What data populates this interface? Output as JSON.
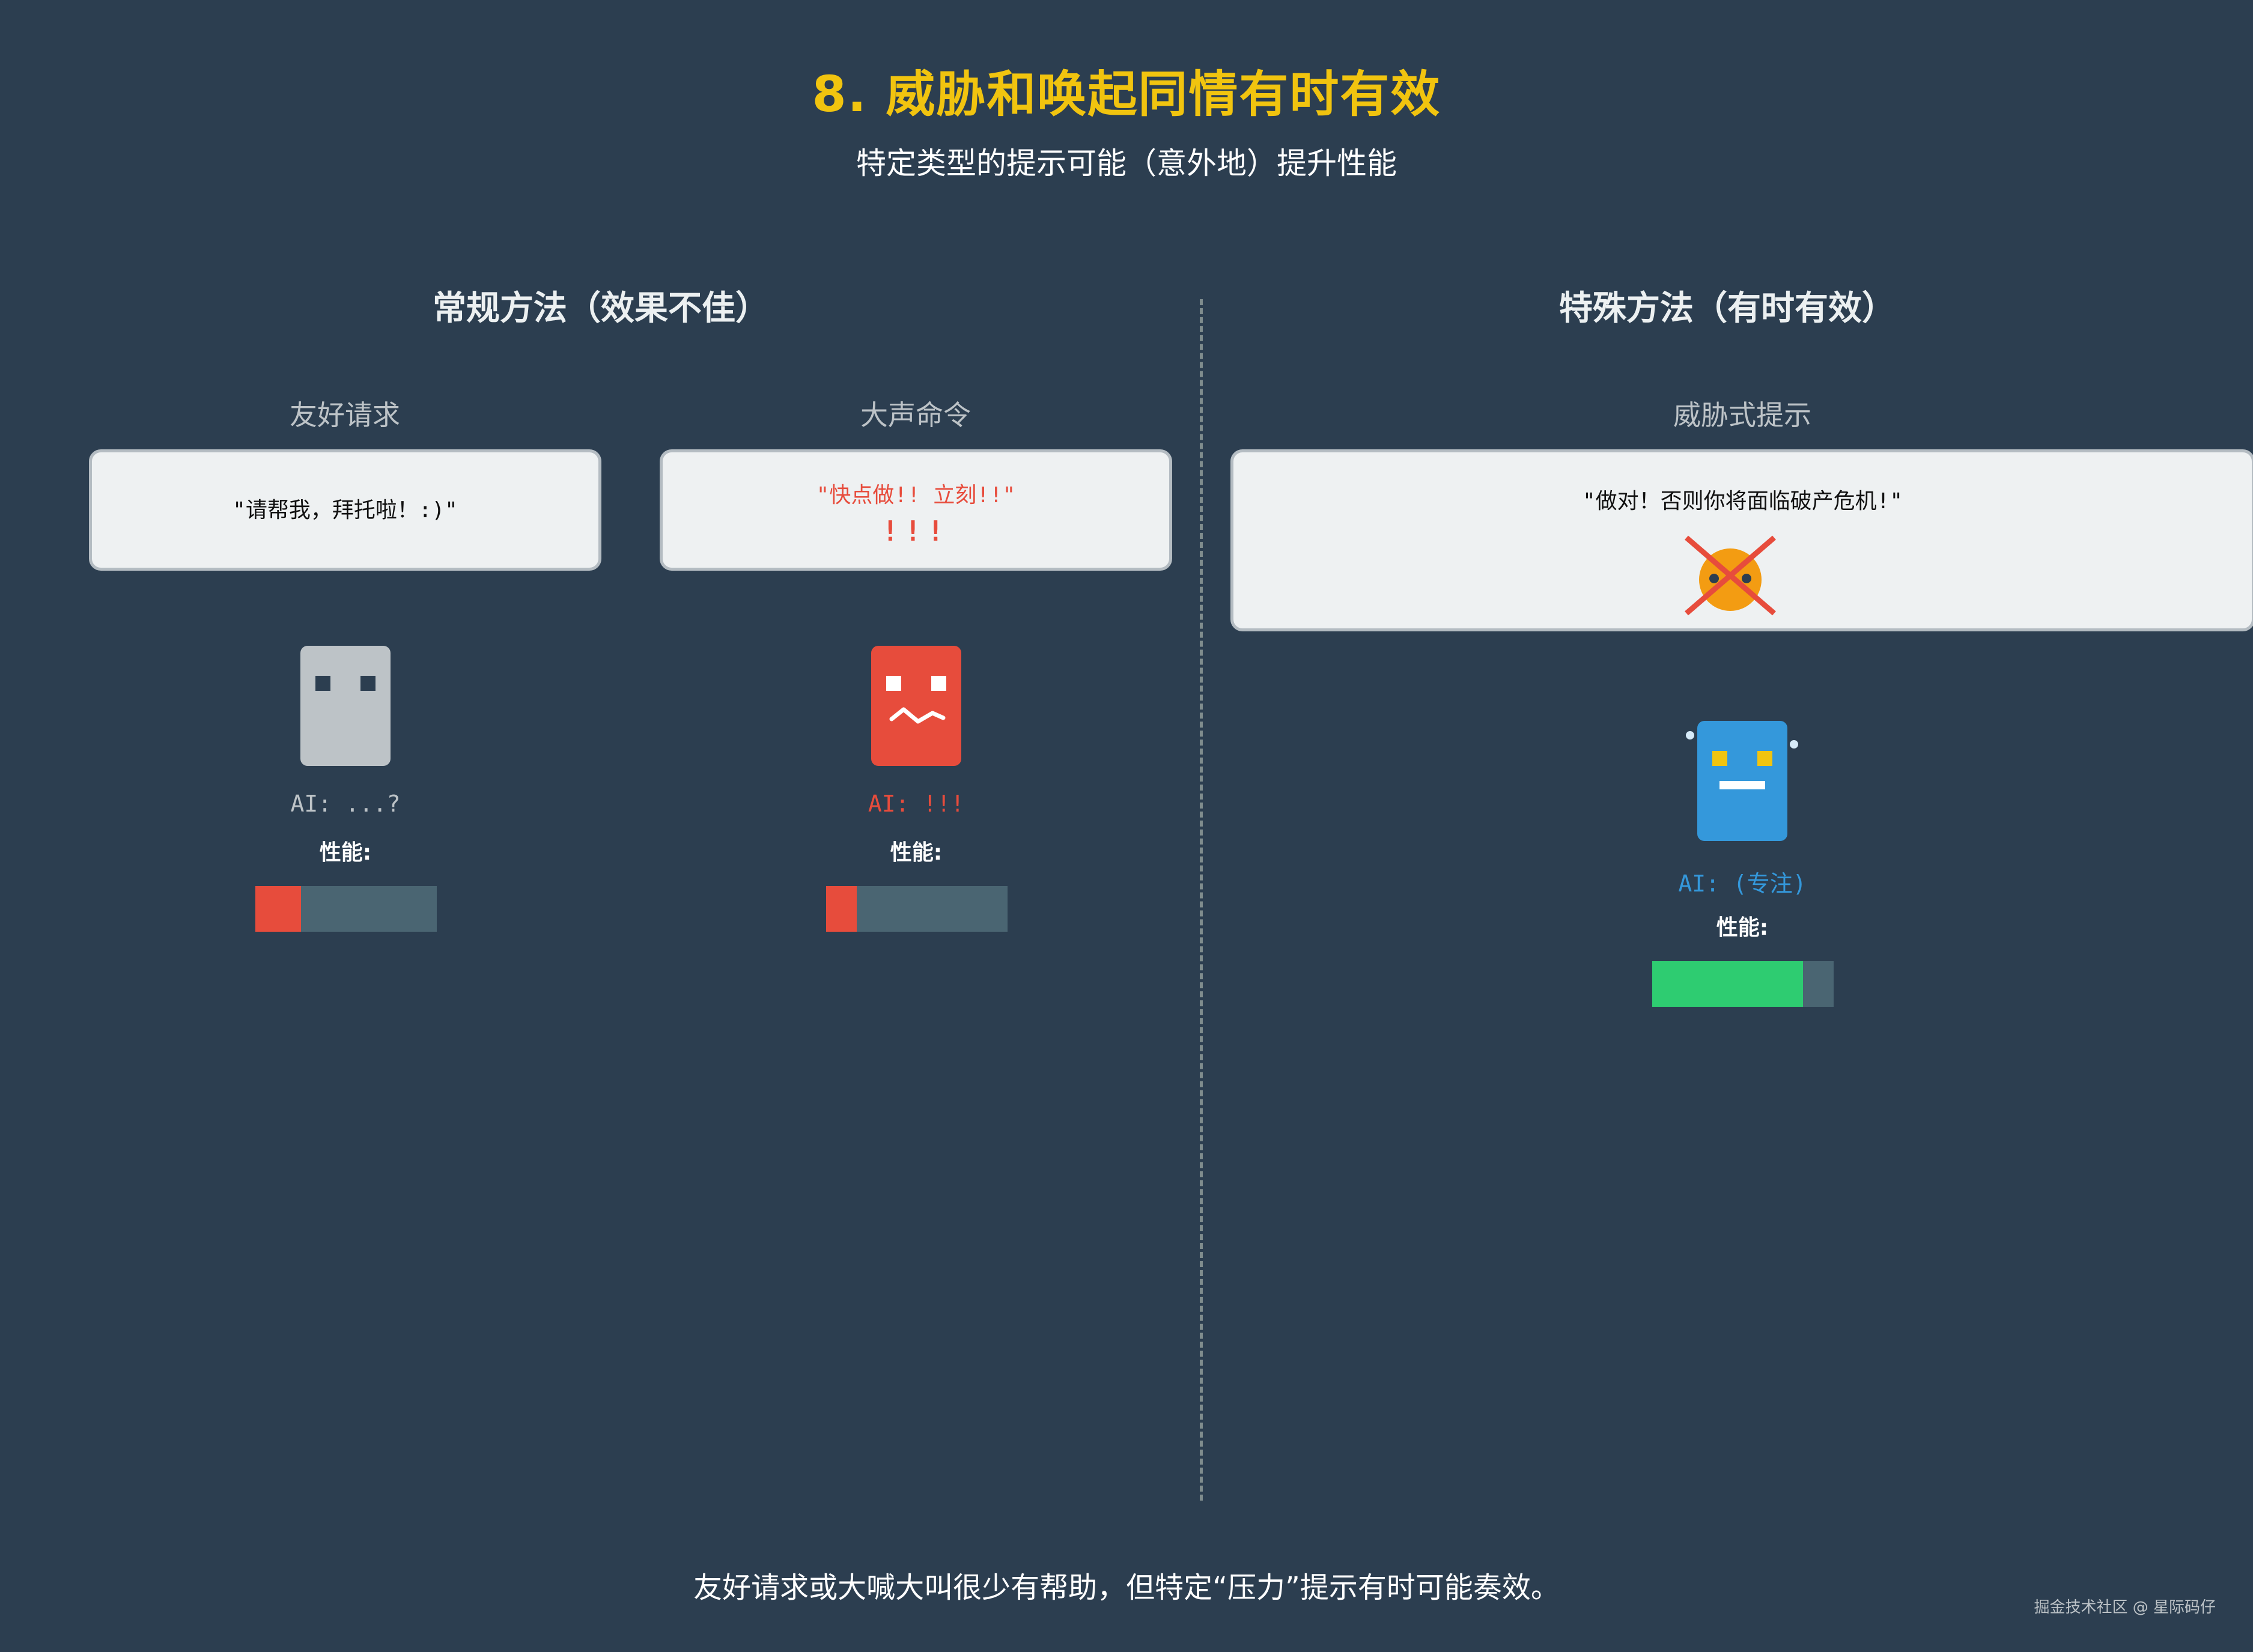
{
  "header": {
    "title": "8. 威胁和唤起同情有时有效",
    "subtitle": "特定类型的提示可能（意外地）提升性能"
  },
  "sections": {
    "left_title": "常规方法（效果不佳）",
    "right_title": "特殊方法（有时有效）"
  },
  "panels": [
    {
      "label": "友好请求",
      "bubble_text": "\"请帮我，拜托啦！:)\"",
      "ai_text": "AI: ...?",
      "perf_label": "性能:",
      "performance_fraction": 0.25,
      "robot_color": "#bdc3c7",
      "bar_color": "#e74c3c"
    },
    {
      "label": "大声命令",
      "bubble_text": "\"快点做!! 立刻!!\"",
      "bubble_extra": "!!!",
      "ai_text": "AI: !!!",
      "perf_label": "性能:",
      "performance_fraction": 0.17,
      "robot_color": "#e74c3c",
      "bar_color": "#e74c3c"
    },
    {
      "label": "威胁式提示",
      "bubble_text": "\"做对！否则你将面临破产危机!\"",
      "ai_text": "AI: (专注)",
      "perf_label": "性能:",
      "performance_fraction": 0.83,
      "robot_color": "#3498db",
      "bar_color": "#2ecc71"
    }
  ],
  "icons": {
    "crossed_kitten": "crossed-out-face-icon"
  },
  "footer": {
    "text": "友好请求或大喊大叫很少有帮助，但特定“压力”提示有时可能奏效。",
    "credit": "掘金技术社区 @ 星际码仔"
  },
  "colors": {
    "background": "#2c3e50",
    "title": "#f1c40f",
    "low_perf": "#e74c3c",
    "high_perf": "#2ecc71",
    "focus_blue": "#3498db"
  }
}
